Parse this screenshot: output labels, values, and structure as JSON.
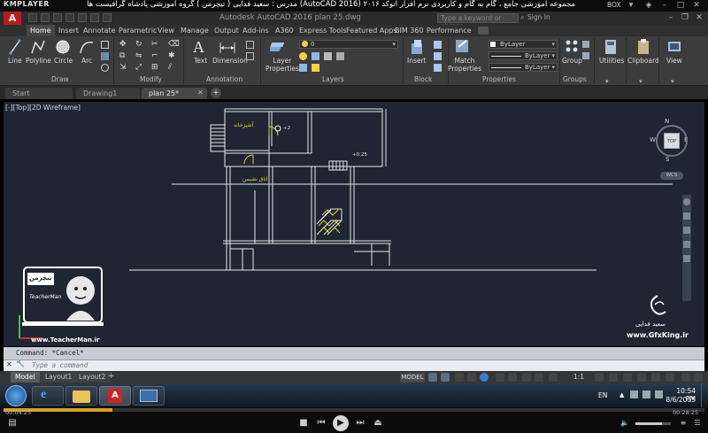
{
  "player": {
    "name": "KMPLAYER",
    "caption": "مجموعه آموزشی جامع ، گام به گام و کاربردی نرم افزار اتوکد ۲۰۱۶ (AutoCAD 2016) مدرس : سعید فدایی ( تیچرمن ) گروه آموزشی پادشاه گرافیست ها",
    "box_label": "BOX",
    "elapsed": "00:04:23",
    "duration": "00:28:25",
    "progress": 0.155
  },
  "autocad": {
    "logo": "A",
    "title": "Autodesk AutoCAD 2016   plan 25.dwg",
    "search_placeholder": "Type a keyword or phrase",
    "sign_in": "Sign In",
    "tabs": [
      "Home",
      "Insert",
      "Annotate",
      "Parametric",
      "View",
      "Manage",
      "Output",
      "Add-ins",
      "A360",
      "Express Tools",
      "Featured Apps",
      "BIM 360",
      "Performance"
    ],
    "active_tab": "Home",
    "ribbon": {
      "draw_tools": [
        "Line",
        "Polyline",
        "Circle",
        "Arc"
      ],
      "text_label": "Text",
      "dimension_label": "Dimension",
      "layer_props_label": "Layer\nProperties",
      "layer_current": "0",
      "insert_label": "Insert",
      "match_props_label": "Match\nProperties",
      "prop_color": "ByLayer",
      "prop_linetype": "ByLayer",
      "prop_lineweight": "ByLayer",
      "group_label": "Group",
      "utilities_label": "Utilities",
      "clipboard_label": "Clipboard",
      "view_label": "View",
      "panels": [
        "Draw",
        "Modify",
        "Annotation",
        "Layers",
        "Block",
        "Properties",
        "Groups"
      ]
    },
    "file_tabs": [
      "Start",
      "Drawing1",
      "plan 25*"
    ],
    "active_file": "plan 25*",
    "viewport_label": "[-][Top][2D Wireframe]",
    "viewcube": {
      "top": "TOP",
      "n": "N",
      "s": "S",
      "e": "E",
      "w": "W",
      "wcs": "WCS"
    },
    "drawing_labels": {
      "kitchen": "آشپزخانه",
      "living": "اتاق نشیمن",
      "level1": "+2",
      "level2": "+0.25"
    },
    "command_history": "Command: *Cancel*",
    "command_placeholder": "Type a command",
    "layout_tabs": [
      "Model",
      "Layout1",
      "Layout2"
    ],
    "active_layout": "Model",
    "status_model": "MODEL",
    "status_scale": "1:1"
  },
  "watermarks": {
    "left_logo_text": "تیچرمن",
    "left_caption": "TeacherMan",
    "left_url": "www.TeacherMan.ir",
    "right_name": "سعید فدایی",
    "right_url": "www.GfxKing.ir"
  },
  "taskbar": {
    "lang": "EN",
    "time": "10:54 PM",
    "date": "8/6/2015"
  }
}
